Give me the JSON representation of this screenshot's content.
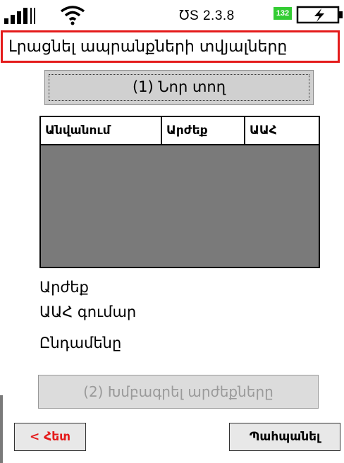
{
  "status_bar": {
    "version_text": "℧S 2.3.8",
    "badge": "132",
    "signal_icon": "signal-bars-icon",
    "wifi_icon": "wifi-icon",
    "battery_icon": "battery-charging-icon"
  },
  "title": "Լրացնել ապրանքների տվյալները",
  "new_row_button": "(1) Նոր տող",
  "table": {
    "headers": [
      "Անվանում",
      "Արժեք",
      "ԱԱՀ"
    ]
  },
  "labels": {
    "value": "Արժեք",
    "vat_amount": "ԱԱՀ գումար",
    "total": "Ընդամենը"
  },
  "edit_button": "(2) Խմբագրել արժեքները",
  "back_button": "< Հետ",
  "save_button": "Պահպանել",
  "colors": {
    "title_border": "#e41b1b",
    "table_body": "#7a7a7a",
    "badge": "#33cc33",
    "back_text": "#e41b1b"
  }
}
